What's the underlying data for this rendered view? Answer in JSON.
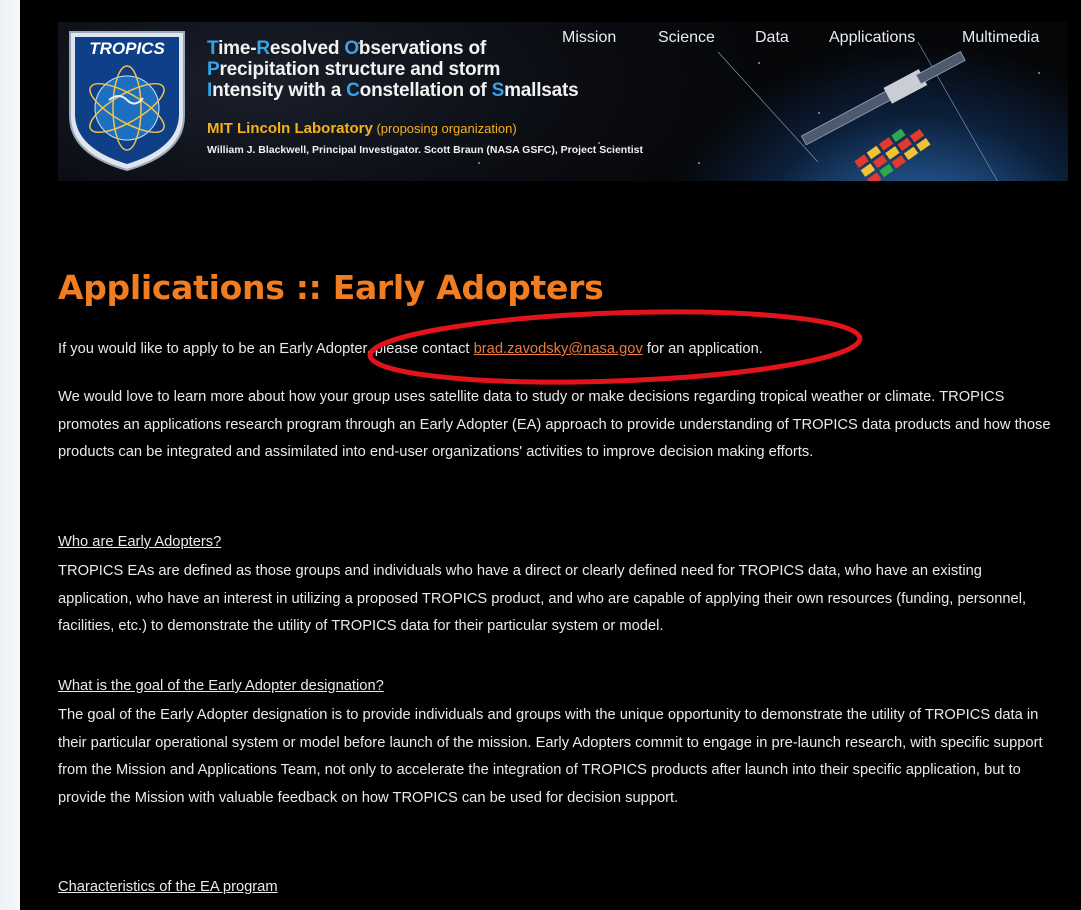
{
  "header": {
    "title_lines": [
      [
        {
          "cap": "T",
          "rest": "ime-"
        },
        {
          "cap": "R",
          "rest": "esolved "
        },
        {
          "cap": "O",
          "rest": "bservations of"
        }
      ],
      [
        {
          "cap": "P",
          "rest": "recipitation structure and storm"
        }
      ],
      [
        {
          "cap": "I",
          "rest": "ntensity with a "
        },
        {
          "cap": "C",
          "rest": "onstellation of "
        },
        {
          "cap": "S",
          "rest": "mallsats"
        }
      ]
    ],
    "lab_name": "MIT Lincoln Laboratory",
    "lab_role": " (proposing organization)",
    "people": "William J. Blackwell, Principal Investigator.  Scott Braun (NASA GSFC), Project Scientist",
    "logo_text": "TROPICS"
  },
  "nav": [
    "Mission",
    "Science",
    "Data",
    "Applications",
    "Multimedia"
  ],
  "page": {
    "heading": "Applications :: Early Adopters",
    "contact_before": "If you would like to apply to be an Early Adopter, please contact ",
    "contact_email": "brad.zavodsky@nasa.gov",
    "contact_after": " for an application.",
    "intro": "We would love to learn more about how your group uses satellite data to study or make decisions regarding tropical weather or climate. TROPICS promotes an applications research program through an Early Adopter (EA) approach to provide understanding of TROPICS data products and how those products can be integrated and assimilated into end-user organizations' activities to improve decision making efforts.",
    "sections": [
      {
        "title": "Who are Early Adopters?",
        "body": "TROPICS EAs are defined as those groups and individuals who have a direct or clearly defined need for TROPICS data, who have an existing application, who have an interest in utilizing a proposed TROPICS product, and who are capable of applying their own resources (funding, personnel, facilities, etc.) to demonstrate the utility of TROPICS data for their particular system or model."
      },
      {
        "title": "What is the goal of the Early Adopter designation?",
        "body": "The goal of the Early Adopter designation is to provide individuals and groups with the unique opportunity to demonstrate the utility of TROPICS data in their particular operational system or model before launch of the mission. Early Adopters commit to engage in pre-launch research, with specific support from the Mission and Applications Team, not only to accelerate the integration of TROPICS products after launch into their specific application, but to provide the Mission with valuable feedback on how TROPICS can be used for decision support."
      },
      {
        "title": "Characteristics of the EA program",
        "body": ""
      }
    ]
  },
  "colors": {
    "background": "#000000",
    "heading": "#f07d22",
    "link": "#e97a3f",
    "title_capital": "#37a4e8",
    "lab": "#f6b21a",
    "annotation_ellipse": "#e0141a"
  }
}
